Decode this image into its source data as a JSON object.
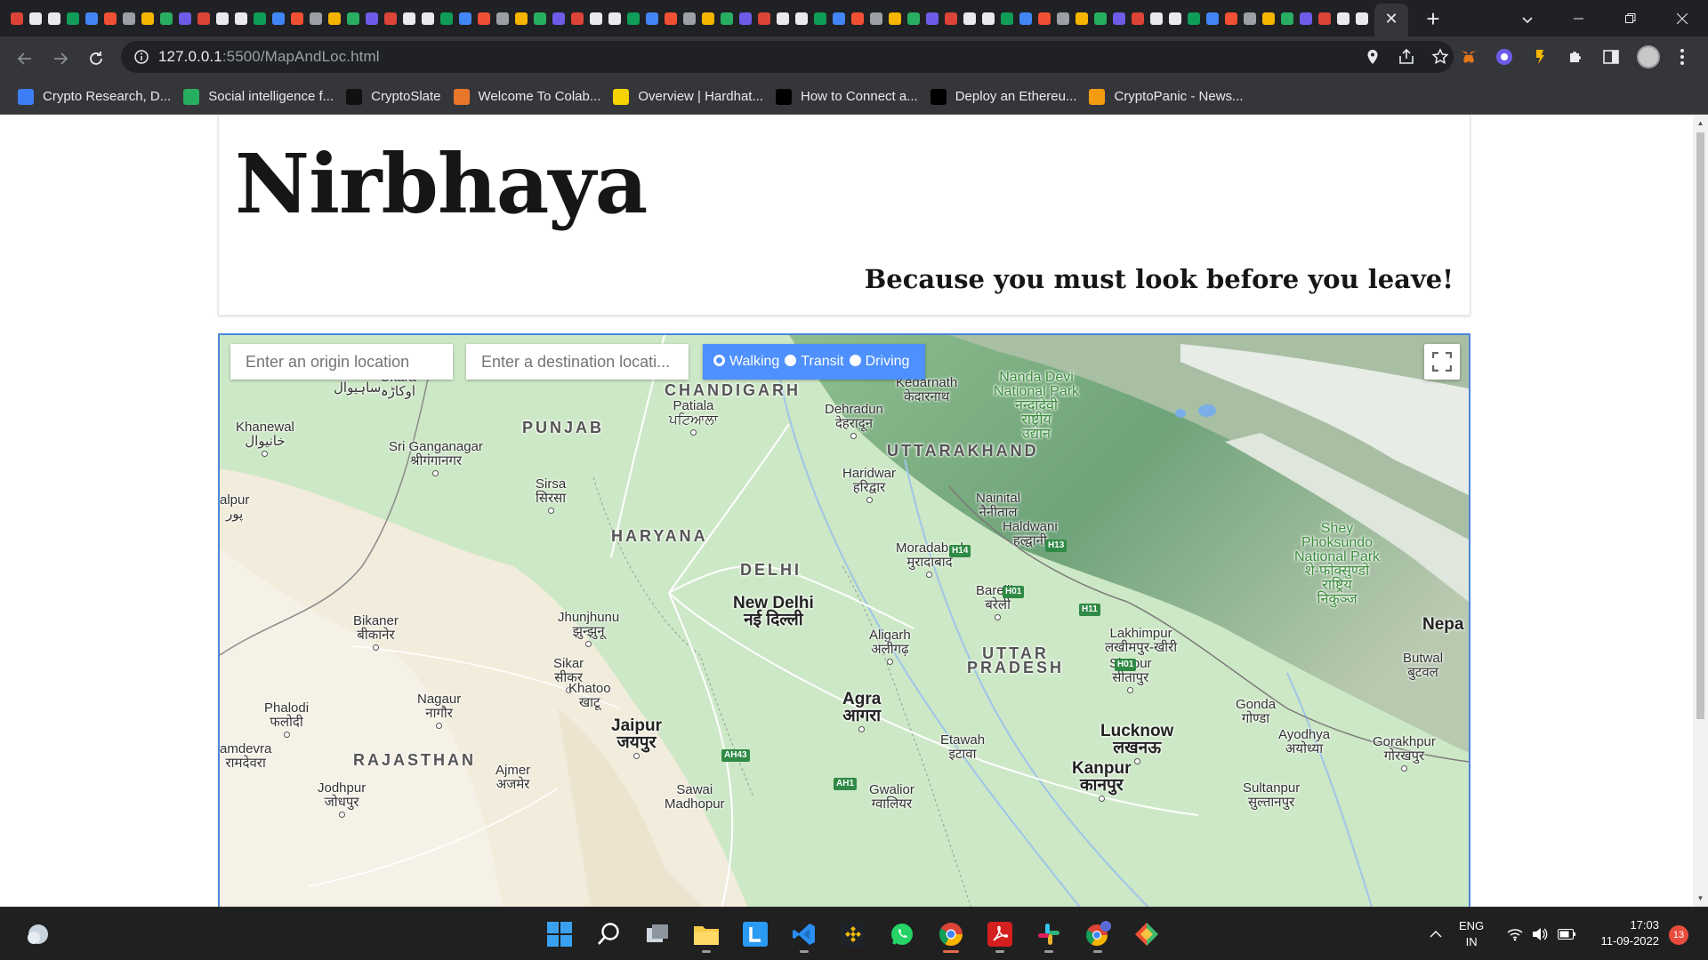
{
  "browser": {
    "tab_close": "✕",
    "new_tab": "+",
    "url_host": "127.0.0.1",
    "url_rest": ":5500/MapAndLoc.html",
    "bookmarks": [
      {
        "label": "Crypto Research, D...",
        "icon_color": "#3d7ef7",
        "icon": "crypto-research-icon"
      },
      {
        "label": "Social intelligence f...",
        "icon_color": "#27ae60",
        "icon": "social-intelligence-icon"
      },
      {
        "label": "CryptoSlate",
        "icon_color": "#111111",
        "icon": "cryptoslate-icon"
      },
      {
        "label": "Welcome To Colab...",
        "icon_color": "#e9772b",
        "icon": "colab-icon"
      },
      {
        "label": "Overview | Hardhat...",
        "icon_color": "#f5d300",
        "icon": "hardhat-icon"
      },
      {
        "label": "How to Connect a...",
        "icon_color": "#000000",
        "icon": "medium-icon"
      },
      {
        "label": "Deploy an Ethereu...",
        "icon_color": "#000000",
        "icon": "medium-icon"
      },
      {
        "label": "CryptoPanic - News...",
        "icon_color": "#f39c12",
        "icon": "cryptopanic-icon"
      }
    ]
  },
  "page": {
    "title": "Nirbhaya",
    "tagline": "Because you must look before you leave!"
  },
  "map": {
    "origin_placeholder": "Enter an origin location",
    "destination_placeholder": "Enter a destination locati...",
    "modes": [
      {
        "label": "Walking",
        "checked": true
      },
      {
        "label": "Transit",
        "checked": false
      },
      {
        "label": "Driving",
        "checked": false
      }
    ],
    "labels": {
      "sahiwal": "Sahiwal\nساہیوال",
      "okara": "Okara\nاوکاڑہ",
      "khanewal": "Khanewal\nخانیوال",
      "alpur": "alpur\nپور",
      "chandigarh": "CHANDIGARH",
      "patiala": "Patiala\nਪਟਿਆਲਾ",
      "punjab": "PUNJAB",
      "sri_ganganagar": "Sri Ganganagar\nश्रीगंगानगर",
      "sirsa": "Sirsa\nसिरसा",
      "haryana": "HARYANA",
      "delhi": "DELHI",
      "new_delhi": "New Delhi\nनई दिल्ली",
      "dehradun": "Dehradun\nदेहरादून",
      "kedarnath": "Kedarnath\nकेदारनाथ",
      "nanda_devi": "Nanda Devi\nNational Park\nनन्दादेवी\nराष्ट्रीय\nउद्यान",
      "uttarakhand": "UTTARAKHAND",
      "haridwar": "Haridwar\nहरिद्वार",
      "nainital": "Nainital\nनैनीताल",
      "haldwani": "Haldwani\nहल्द्वानी",
      "moradabad": "Moradabad\nमुरादाबाद",
      "bareilly": "Bareilly\nबरेली",
      "shey": "Shey\nPhoksundo\nNational Park\nशे-फोक्सुण्डो\nराष्ट्रिय\nनिकुञ्ज",
      "nepal": "Nepa",
      "bikaner": "Bikaner\nबीकानेर",
      "jhunjhunu": "Jhunjhunu\nझुन्झुनू",
      "sikar": "Sikar\nसीकर",
      "khatoo": "Khatoo\nखाटू",
      "aligarh": "Aligarh\nअलीगढ़",
      "uttar_pradesh": "UTTAR\nPRADESH",
      "lakhimpur": "Lakhimpur\nलखीमपुर-खीरी",
      "sitapur": "Sitapur\nसीतापुर",
      "butwal": "Butwal\nबुटवल",
      "phalodi": "Phalodi\nफलोदी",
      "nagaur": "Nagaur\nनागौर",
      "jaipur": "Jaipur\nजयपुर",
      "agra": "Agra\nआगरा",
      "etawah": "Etawah\nइटावा",
      "lucknow": "Lucknow\nलखनऊ",
      "gonda": "Gonda\nगोण्डा",
      "ayodhya": "Ayodhya\nअयोध्या",
      "gorakhpur": "Gorakhpur\nगोरखपुर",
      "mdevra": "amdevra\nरामदेवरा",
      "rajasthan": "RAJASTHAN",
      "ajmer": "Ajmer\nअजमेर",
      "jodhpur": "Jodhpur\nजोधपुर",
      "sawai": "Sawai\nMadhopur",
      "gwalior": "Gwalior\nग्वालियर",
      "kanpur": "Kanpur\nकानपुर",
      "sultanpur": "Sultanpur\nसुल्तानपुर"
    },
    "highways": [
      "H14",
      "H13",
      "H01",
      "H11",
      "H01",
      "AH43",
      "AH1"
    ]
  },
  "taskbar": {
    "lang_top": "ENG",
    "lang_bottom": "IN",
    "time": "17:03",
    "date": "11-09-2022",
    "notifications": "13"
  }
}
